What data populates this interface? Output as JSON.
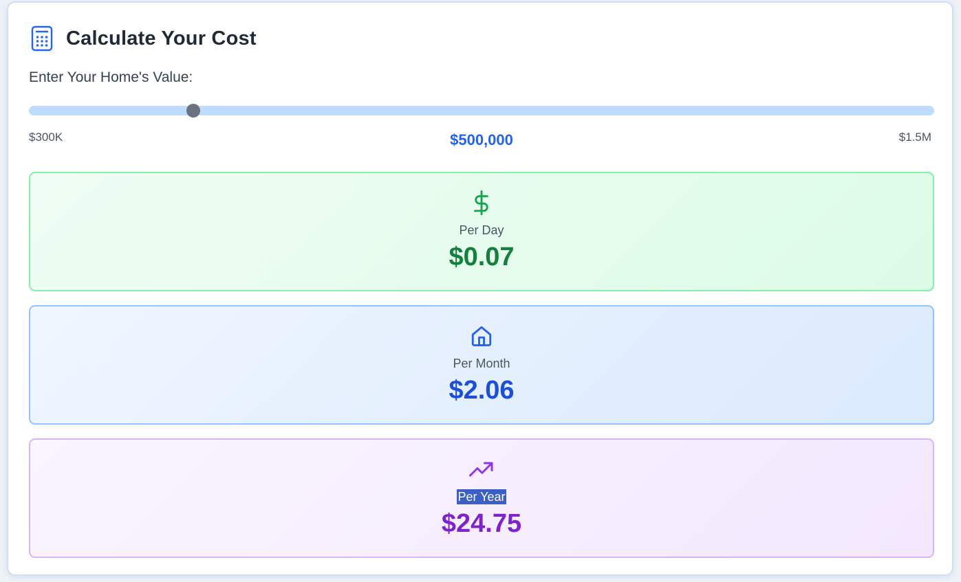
{
  "header": {
    "title": "Calculate Your Cost",
    "icon": "calculator-icon"
  },
  "input": {
    "label": "Enter Your Home's Value:",
    "min_label": "$300K",
    "max_label": "$1.5M",
    "min": 300000,
    "max": 1500000,
    "value": 500000,
    "value_display": "$500,000"
  },
  "results": {
    "day": {
      "label": "Per Day",
      "value": "$0.07",
      "icon": "dollar-sign-icon",
      "color": "#16a34a"
    },
    "month": {
      "label": "Per Month",
      "value": "$2.06",
      "icon": "home-icon",
      "color": "#2563eb"
    },
    "year": {
      "label": "Per Year",
      "value": "$24.75",
      "icon": "trending-up-icon",
      "color": "#9333ea"
    }
  }
}
